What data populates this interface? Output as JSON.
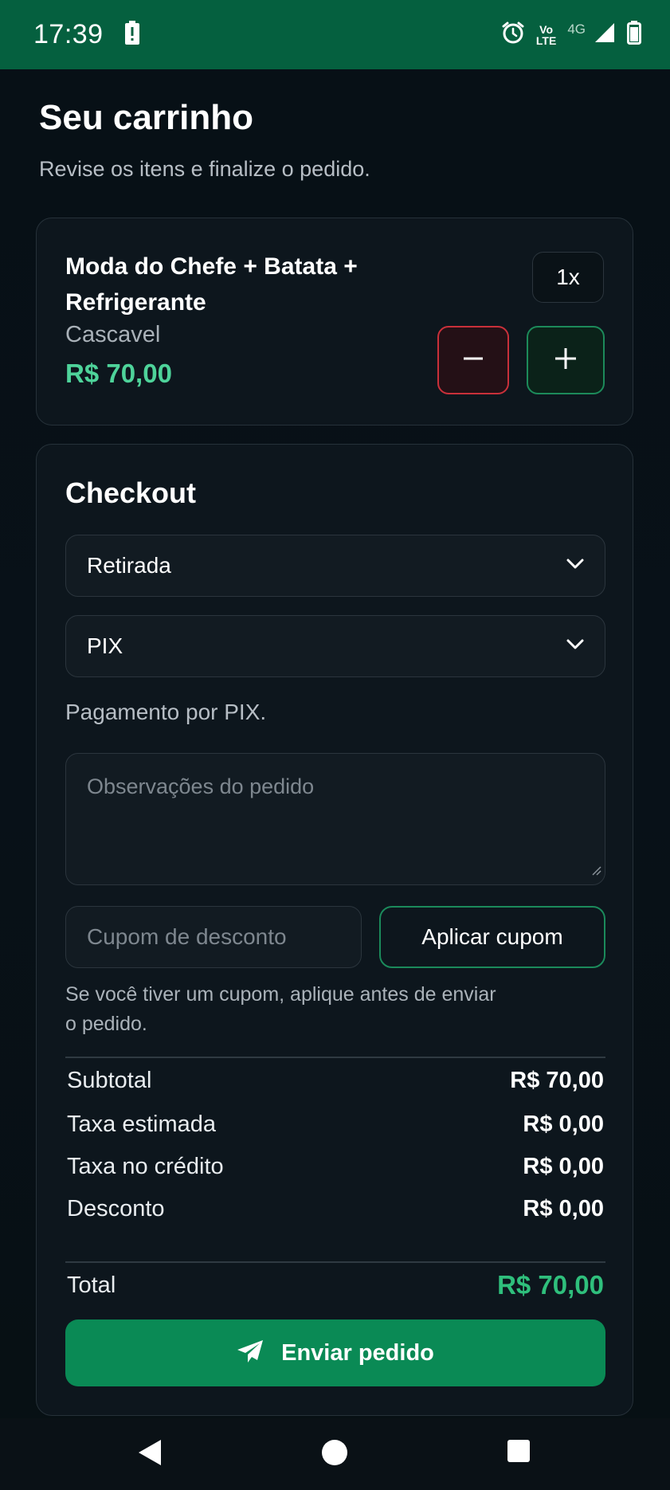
{
  "status_bar": {
    "time": "17:39",
    "volte_line1": "Vo",
    "volte_line2": "LTE",
    "network": "4G",
    "icons": [
      "battery-alert-icon",
      "alarm-icon",
      "volte-icon",
      "signal-icon",
      "battery-icon"
    ]
  },
  "header": {
    "title": "Seu carrinho",
    "subtitle": "Revise os itens e finalize o pedido."
  },
  "cart_item": {
    "name": "Moda do Chefe + Batata + Refrigerante",
    "city": "Cascavel",
    "price": "R$ 70,00",
    "quantity": "1x",
    "minus_icon": "minus-icon",
    "plus_icon": "plus-icon"
  },
  "checkout": {
    "title": "Checkout",
    "delivery_select": "Retirada",
    "payment_select": "PIX",
    "payment_note": "Pagamento por PIX.",
    "notes_placeholder": "Observações do pedido",
    "coupon_placeholder": "Cupom de desconto",
    "coupon_button": "Aplicar cupom",
    "coupon_hint": "Se você tiver um cupom, aplique antes de enviar o pedido.",
    "summary": [
      {
        "label": "Subtotal",
        "value": "R$ 70,00"
      },
      {
        "label": "Taxa estimada",
        "value": "R$ 0,00"
      },
      {
        "label": "Taxa no crédito",
        "value": "R$ 0,00"
      },
      {
        "label": "Desconto",
        "value": "R$ 0,00"
      }
    ],
    "total_label": "Total",
    "total_value": "R$ 70,00",
    "send_button": "Enviar pedido",
    "send_icon": "paper-plane-icon"
  },
  "colors": {
    "status_bar": "#05603f",
    "accent_green": "#4ed39a",
    "button_green": "#0a8a55",
    "minus_border": "#c9303a"
  }
}
